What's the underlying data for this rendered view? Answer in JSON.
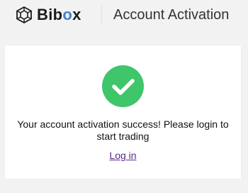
{
  "header": {
    "logo": {
      "text_main": "Bib",
      "text_accent": "o",
      "text_end": "x",
      "icon": "cube-logo-icon",
      "accent_color": "#3d7fd6"
    },
    "title": "Account Activation"
  },
  "card": {
    "status_icon": "checkmark-circle-icon",
    "status_color": "#3fc56a",
    "message": "Your account activation success! Please login to start trading",
    "login_link": "Log in"
  }
}
